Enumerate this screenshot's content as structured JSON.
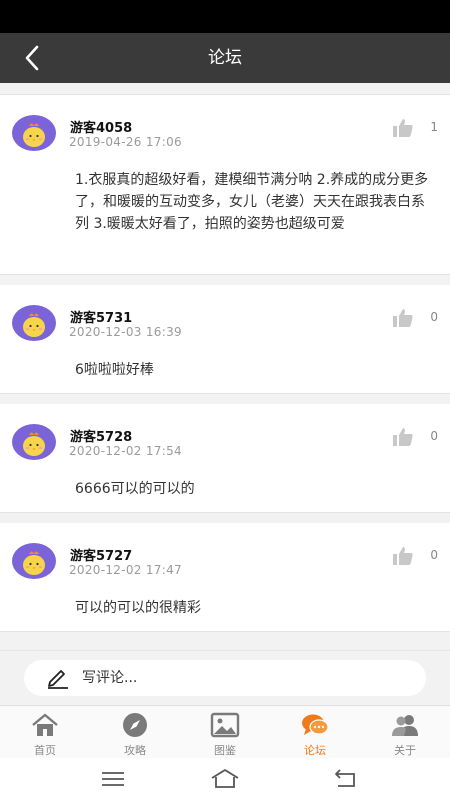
{
  "header": {
    "title": "论坛"
  },
  "posts": [
    {
      "user": "游客4058",
      "time": "2019-04-26 17:06",
      "likes": "1",
      "body": "1.衣服真的超级好看，建模细节满分呐 2.养成的成分更多了，和暖暖的互动变多，女儿（老婆）天天在跟我表白系列 3.暖暖太好看了，拍照的姿势也超级可爱"
    },
    {
      "user": "游客5731",
      "time": "2020-12-03 16:39",
      "likes": "0",
      "body": "6啦啦啦好棒"
    },
    {
      "user": "游客5728",
      "time": "2020-12-02 17:54",
      "likes": "0",
      "body": "6666可以的可以的"
    },
    {
      "user": "游客5727",
      "time": "2020-12-02 17:47",
      "likes": "0",
      "body": "可以的可以的很精彩"
    }
  ],
  "comment": {
    "placeholder": "写评论..."
  },
  "tabs": [
    {
      "label": "首页",
      "icon": "home-icon"
    },
    {
      "label": "攻略",
      "icon": "compass-icon"
    },
    {
      "label": "图鉴",
      "icon": "image-icon"
    },
    {
      "label": "论坛",
      "icon": "chat-icon"
    },
    {
      "label": "关于",
      "icon": "users-icon"
    }
  ],
  "colors": {
    "header_bg": "#3a3a3a",
    "accent": "#f07a1a",
    "avatar_bg": "#7b64d8"
  }
}
